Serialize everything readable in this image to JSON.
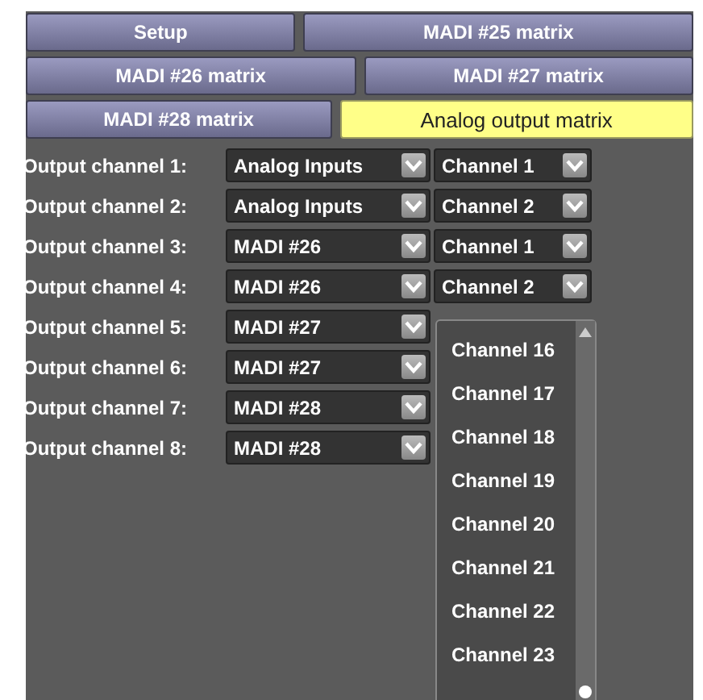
{
  "tab_rows": [
    [
      {
        "label": "Setup",
        "selected": false
      },
      {
        "label": "MADI #25 matrix",
        "selected": false
      }
    ],
    [
      {
        "label": "MADI #26 matrix",
        "selected": false
      },
      {
        "label": "MADI #27 matrix",
        "selected": false
      }
    ],
    [
      {
        "label": "MADI #28 matrix",
        "selected": false
      },
      {
        "label": "Analog output matrix",
        "selected": true
      }
    ]
  ],
  "outputs": [
    {
      "label": "Output channel 1:",
      "source": "Analog Inputs",
      "channel": "Channel 1"
    },
    {
      "label": "Output channel 2:",
      "source": "Analog Inputs",
      "channel": "Channel 2"
    },
    {
      "label": "Output channel 3:",
      "source": "MADI #26",
      "channel": "Channel 1"
    },
    {
      "label": "Output channel 4:",
      "source": "MADI #26",
      "channel": "Channel 2"
    },
    {
      "label": "Output channel 5:",
      "source": "MADI #27"
    },
    {
      "label": "Output channel 6:",
      "source": "MADI #27"
    },
    {
      "label": "Output channel 7:",
      "source": "MADI #28"
    },
    {
      "label": "Output channel 8:",
      "source": "MADI #28"
    }
  ],
  "open_list": {
    "items": [
      {
        "label": "Channel 16",
        "selected": false
      },
      {
        "label": "Channel 17",
        "selected": false
      },
      {
        "label": "Channel 18",
        "selected": false
      },
      {
        "label": "Channel 19",
        "selected": false
      },
      {
        "label": "Channel 20",
        "selected": false
      },
      {
        "label": "Channel 21",
        "selected": false
      },
      {
        "label": "Channel 22",
        "selected": false
      },
      {
        "label": "Channel 23",
        "selected": false
      }
    ]
  }
}
